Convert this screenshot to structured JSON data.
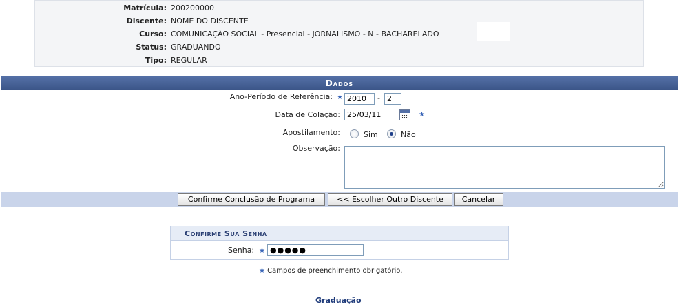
{
  "student_info": {
    "rows": [
      {
        "label": "Matrícula:",
        "value": "200200000"
      },
      {
        "label": "Discente:",
        "value": "NOME DO DISCENTE"
      },
      {
        "label": "Curso:",
        "value": "COMUNICAÇÃO SOCIAL - Presencial - JORNALISMO - N - BACHARELADO"
      },
      {
        "label": "Status:",
        "value": "GRADUANDO"
      },
      {
        "label": "Tipo:",
        "value": "REGULAR"
      }
    ]
  },
  "dados": {
    "title": "Dados",
    "ano_periodo": {
      "label": "Ano-Período de Referência:",
      "ano": "2010",
      "separator": "-",
      "periodo": "2"
    },
    "data_colacao": {
      "label": "Data de Colação:",
      "value": "25/03/11"
    },
    "apostilamento": {
      "label": "Apostilamento:",
      "options": [
        "Sim",
        "Não"
      ],
      "selected": "Não"
    },
    "observacao": {
      "label": "Observação:",
      "value": ""
    },
    "buttons": {
      "confirm": "Confirme Conclusão de Programa",
      "choose_other": "<< Escolher Outro Discente",
      "cancel": "Cancelar"
    }
  },
  "senha": {
    "title": "Confirme Sua Senha",
    "label": "Senha:",
    "value": "●●●●●"
  },
  "footnote": "Campos de preenchimento obrigatório.",
  "required_marker": "★",
  "footer_link": "Graduação",
  "colors": {
    "header_bg": "#3b5588",
    "button_bar": "#c9d4ea",
    "required_star": "#3a66b8"
  }
}
